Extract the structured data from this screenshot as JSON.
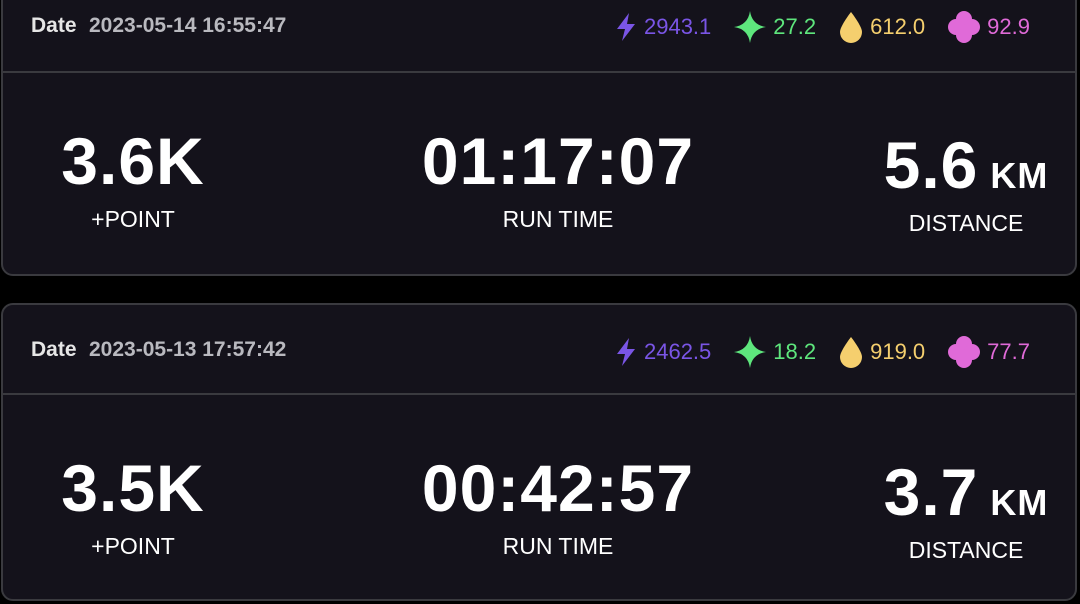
{
  "records": [
    {
      "date_label": "Date",
      "date_value": "2023-05-14 16:55:47",
      "stats": {
        "energy": "2943.1",
        "spark": "27.2",
        "drop": "612.0",
        "clover": "92.9"
      },
      "point_value": "3.6K",
      "point_label": "+POINT",
      "time_value": "01:17:07",
      "time_label": "RUN TIME",
      "distance_value": "5.6",
      "distance_unit": "KM",
      "distance_label": "DISTANCE"
    },
    {
      "date_label": "Date",
      "date_value": "2023-05-13 17:57:42",
      "stats": {
        "energy": "2462.5",
        "spark": "18.2",
        "drop": "919.0",
        "clover": "77.7"
      },
      "point_value": "3.5K",
      "point_label": "+POINT",
      "time_value": "00:42:57",
      "time_label": "RUN TIME",
      "distance_value": "3.7",
      "distance_unit": "KM",
      "distance_label": "DISTANCE"
    }
  ],
  "icons": {
    "energy": "lightning-bolt-icon",
    "spark": "four-point-star-icon",
    "drop": "drop-icon",
    "clover": "clover-icon"
  },
  "colors": {
    "background": "#000000",
    "card": "#14121b",
    "border": "#3a3a3f",
    "energy": "#7a55e6",
    "spark": "#5ee67d",
    "drop": "#f5cf6e",
    "clover": "#e06ad8"
  }
}
